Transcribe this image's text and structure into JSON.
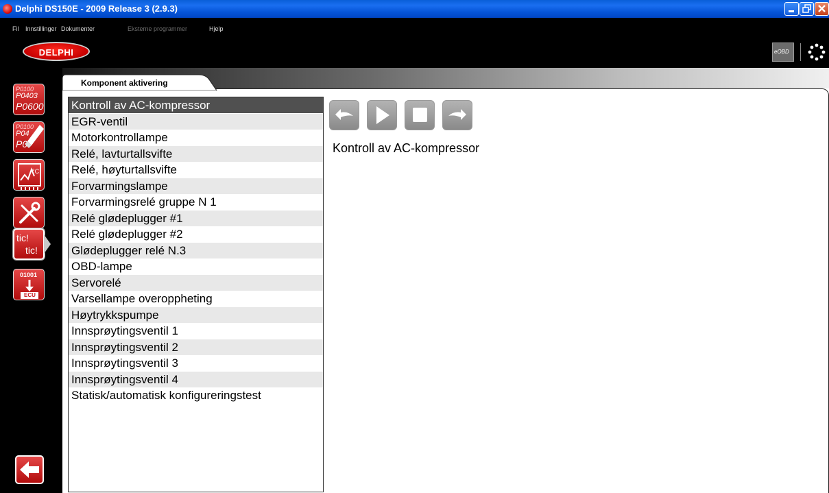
{
  "window": {
    "title": "Delphi DS150E - 2009 Release 3 (2.9.3)"
  },
  "menu": [
    {
      "label": "Fil",
      "enabled": true
    },
    {
      "label": "Innstillinger",
      "enabled": true
    },
    {
      "label": "Dokumenter",
      "enabled": true
    },
    {
      "label": "Eksterne programmer",
      "enabled": false
    },
    {
      "label": "Hjelp",
      "enabled": true
    }
  ],
  "brand": {
    "logo_text": "DELPHI",
    "eobd_label": "eOBD"
  },
  "tab": {
    "label": "Komponent aktivering"
  },
  "sidebar": {
    "icons": [
      {
        "name": "fault-codes-icon",
        "lines": [
          "P0100",
          "P0403",
          "P0600"
        ]
      },
      {
        "name": "clear-fault-codes-icon",
        "lines": [
          "P0100",
          "P04",
          "P0"
        ]
      },
      {
        "name": "live-data-icon"
      },
      {
        "name": "adjustments-tools-icon"
      },
      {
        "name": "component-activation-icon",
        "lines": [
          "tic!",
          "tic!"
        ]
      },
      {
        "name": "ecu-programming-icon",
        "lines": [
          "01001",
          "ECU"
        ]
      }
    ]
  },
  "list": {
    "selected_index": 0,
    "items": [
      "Kontroll av AC-kompressor",
      "EGR-ventil",
      "Motorkontrollampe",
      "Relé, lavturtallsvifte",
      "Relé, høyturtallsvifte",
      "Forvarmingslampe",
      "Forvarmingsrelé gruppe N 1",
      "Relé glødeplugger #1",
      "Relé glødeplugger #2",
      "Glødeplugger relé N.3",
      "OBD-lampe",
      "Servorelé",
      "Varsellampe overoppheting",
      "Høytrykkspumpe",
      "Innsprøytingsventil 1",
      "Innsprøytingsventil 2",
      "Innsprøytingsventil 3",
      "Innsprøytingsventil 4",
      "Statisk/automatisk konfigureringstest"
    ]
  },
  "detail": {
    "title": "Kontroll av AC-kompressor"
  },
  "colors": {
    "accent_red": "#c8161d",
    "selected_row": "#505050",
    "alt_row": "#e8e8e8",
    "titlebar": "#0a5fd8"
  }
}
